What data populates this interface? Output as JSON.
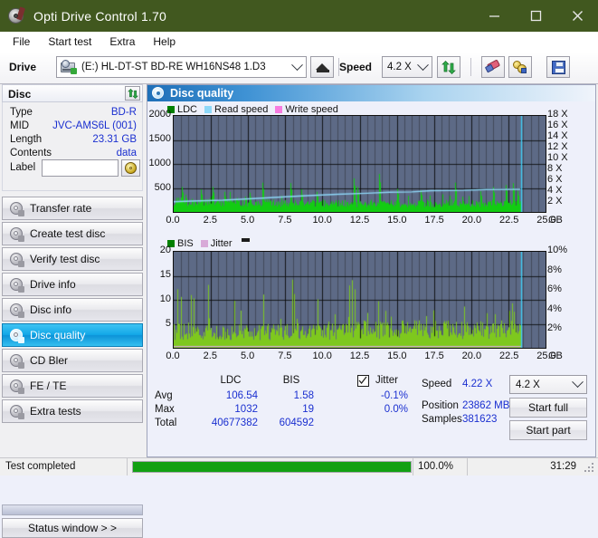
{
  "window": {
    "title": "Opti Drive Control 1.70",
    "minimize": "minimize-button",
    "maximize": "maximize-button",
    "close": "close-button"
  },
  "menu": [
    "File",
    "Start test",
    "Extra",
    "Help"
  ],
  "drive_bar": {
    "drive_label": "Drive",
    "drive_value": "(E:)  HL-DT-ST BD-RE  WH16NS48 1.D3",
    "speed_label": "Speed",
    "speed_value": "4.2 X"
  },
  "disc": {
    "header": "Disc",
    "rows": [
      {
        "key": "Type",
        "value": "BD-R"
      },
      {
        "key": "MID",
        "value": "JVC-AMS6L (001)"
      },
      {
        "key": "Length",
        "value": "23.31 GB"
      },
      {
        "key": "Contents",
        "value": "data"
      }
    ],
    "label_key": "Label",
    "label_value": ""
  },
  "nav": {
    "items": [
      {
        "label": "Transfer rate",
        "selected": false
      },
      {
        "label": "Create test disc",
        "selected": false
      },
      {
        "label": "Verify test disc",
        "selected": false
      },
      {
        "label": "Drive info",
        "selected": false
      },
      {
        "label": "Disc info",
        "selected": false
      },
      {
        "label": "Disc quality",
        "selected": true
      },
      {
        "label": "CD Bler",
        "selected": false
      },
      {
        "label": "FE / TE",
        "selected": false
      },
      {
        "label": "Extra tests",
        "selected": false
      }
    ],
    "status_window": "Status window > >"
  },
  "panel": {
    "title": "Disc quality"
  },
  "stats": {
    "col_ldc": "LDC",
    "col_bis": "BIS",
    "jitter_label": "Jitter",
    "jitter_checked": true,
    "rows": [
      {
        "name": "Avg",
        "ldc": "106.54",
        "bis": "1.58",
        "jitter": "-0.1%"
      },
      {
        "name": "Max",
        "ldc": "1032",
        "bis": "19",
        "jitter": "0.0%"
      },
      {
        "name": "Total",
        "ldc": "40677382",
        "bis": "604592",
        "jitter": ""
      }
    ],
    "speed_label": "Speed",
    "speed_value": "4.22 X",
    "position_label": "Position",
    "position_value": "23862 MB",
    "samples_label": "Samples",
    "samples_value": "381623",
    "result_speed": "4.2 X",
    "start_full": "Start full",
    "start_part": "Start part"
  },
  "statusbar": {
    "message": "Test completed",
    "percent": "100.0%",
    "percent_value": 100,
    "time": "31:29"
  },
  "colors": {
    "title_bg": "#41581f",
    "plot_bg": "#5d6a86",
    "ldc_green": "#12cc12",
    "bis_green": "#7ec81e",
    "read_speed": "#8ed8f8",
    "write_speed": "#f77ce0",
    "jitter_pink": "#d8aad8",
    "value_blue": "#1a2fd0",
    "progress_green": "#12a012",
    "selected_nav": "#12a8e8"
  },
  "chart_data": [
    {
      "type": "area",
      "id": "ldc-chart",
      "title": "",
      "xlabel": "GB",
      "ylabel": "",
      "legend": [
        {
          "label": "LDC",
          "color": "#008000"
        },
        {
          "label": "Read speed",
          "color": "#8ed8f8"
        },
        {
          "label": "Write speed",
          "color": "#f77ce0"
        }
      ],
      "legend_position": "top-left",
      "grid": true,
      "x": {
        "min": 0.0,
        "max": 25.0,
        "ticks": [
          0.0,
          2.5,
          5.0,
          7.5,
          10.0,
          12.5,
          15.0,
          17.5,
          20.0,
          22.5,
          25.0
        ],
        "ticklabels": [
          "0.0",
          "2.5",
          "5.0",
          "7.5",
          "10.0",
          "12.5",
          "15.0",
          "17.5",
          "20.0",
          "22.5",
          "25.0"
        ],
        "unit": "GB"
      },
      "y_left": {
        "min": 0,
        "max": 2000,
        "ticks": [
          0,
          500,
          1000,
          1500,
          2000
        ],
        "ticklabels": [
          "",
          "500",
          "1000",
          "1500",
          "2000"
        ]
      },
      "y_right": {
        "min": 0,
        "max": 18,
        "ticks": [
          2,
          4,
          6,
          8,
          10,
          12,
          14,
          16,
          18
        ],
        "ticklabels": [
          "2 X",
          "4 X",
          "6 X",
          "8 X",
          "10 X",
          "12 X",
          "14 X",
          "16 X",
          "18 X"
        ]
      },
      "data_end_x": 23.35,
      "series": [
        {
          "name": "LDC",
          "color": "#12cc12",
          "axis": "left",
          "baseline": [
            230,
            250,
            235,
            215,
            210,
            205,
            200,
            198,
            205,
            215,
            225,
            210,
            200,
            195,
            200,
            205,
            210,
            200,
            195,
            200,
            205,
            195,
            190,
            185,
            190,
            195,
            200,
            205,
            195,
            190,
            185,
            180,
            185,
            190,
            195,
            185,
            180,
            175,
            180,
            185,
            190,
            185,
            180,
            175,
            180,
            185,
            190,
            195,
            190,
            185,
            180,
            175,
            170,
            175,
            180,
            185,
            190,
            185,
            180,
            175,
            180,
            185,
            190,
            185,
            180,
            175,
            180,
            185,
            180,
            175,
            180,
            185,
            190,
            185,
            180,
            175,
            180,
            185,
            190,
            195,
            185,
            180,
            175,
            180,
            185,
            190,
            185,
            180,
            175,
            180,
            185,
            190,
            185,
            180,
            185,
            190,
            195,
            190,
            185,
            180
          ],
          "peaks": [
            {
              "x": 0.55,
              "y": 520
            },
            {
              "x": 1.8,
              "y": 470
            },
            {
              "x": 2.6,
              "y": 520
            },
            {
              "x": 3.4,
              "y": 420
            },
            {
              "x": 5.1,
              "y": 400
            },
            {
              "x": 5.95,
              "y": 610
            },
            {
              "x": 7.85,
              "y": 600
            },
            {
              "x": 8.6,
              "y": 470
            },
            {
              "x": 9.6,
              "y": 420
            },
            {
              "x": 12.1,
              "y": 700
            },
            {
              "x": 12.35,
              "y": 520
            },
            {
              "x": 13.8,
              "y": 790
            },
            {
              "x": 15.0,
              "y": 480
            },
            {
              "x": 16.6,
              "y": 450
            },
            {
              "x": 18.9,
              "y": 610
            },
            {
              "x": 20.6,
              "y": 430
            },
            {
              "x": 21.5,
              "y": 520
            },
            {
              "x": 22.3,
              "y": 560
            },
            {
              "x": 22.8,
              "y": 600
            },
            {
              "x": 23.1,
              "y": 440
            }
          ]
        },
        {
          "name": "Read speed",
          "color": "#8ed8f8",
          "axis": "right",
          "points": [
            {
              "x": 0.0,
              "y": 1.9
            },
            {
              "x": 1.2,
              "y": 2.05
            },
            {
              "x": 3.3,
              "y": 2.2
            },
            {
              "x": 5.1,
              "y": 2.45
            },
            {
              "x": 7.0,
              "y": 2.75
            },
            {
              "x": 9.0,
              "y": 3.05
            },
            {
              "x": 11.0,
              "y": 3.3
            },
            {
              "x": 13.0,
              "y": 3.5
            },
            {
              "x": 14.5,
              "y": 3.7
            },
            {
              "x": 16.0,
              "y": 3.75
            },
            {
              "x": 17.3,
              "y": 4.0
            },
            {
              "x": 19.5,
              "y": 4.05
            },
            {
              "x": 21.0,
              "y": 4.2
            },
            {
              "x": 23.3,
              "y": 4.25
            }
          ]
        },
        {
          "name": "cursor",
          "color": "#3fd0f7",
          "type": "vline",
          "x": 23.35
        }
      ]
    },
    {
      "type": "area",
      "id": "bis-chart",
      "title": "",
      "xlabel": "GB",
      "ylabel": "",
      "legend": [
        {
          "label": "BIS",
          "color": "#008000"
        },
        {
          "label": "Jitter",
          "color": "#d8aad8"
        }
      ],
      "legend_position": "top-left",
      "grid": true,
      "x": {
        "min": 0.0,
        "max": 25.0,
        "ticks": [
          0.0,
          2.5,
          5.0,
          7.5,
          10.0,
          12.5,
          15.0,
          17.5,
          20.0,
          22.5,
          25.0
        ],
        "ticklabels": [
          "0.0",
          "2.5",
          "5.0",
          "7.5",
          "10.0",
          "12.5",
          "15.0",
          "17.5",
          "20.0",
          "22.5",
          "25.0"
        ],
        "unit": "GB"
      },
      "y_left": {
        "min": 0,
        "max": 20,
        "ticks": [
          5,
          10,
          15,
          20
        ],
        "ticklabels": [
          "5",
          "10",
          "15",
          "20"
        ]
      },
      "y_right": {
        "min": 0,
        "max": 10,
        "ticks": [
          2,
          4,
          6,
          8,
          10
        ],
        "ticklabels": [
          "2%",
          "4%",
          "6%",
          "8%",
          "10%"
        ]
      },
      "data_end_x": 23.35,
      "series": [
        {
          "name": "BIS",
          "color": "#7ec81e",
          "axis": "left",
          "baseline_first_half": 4.6,
          "baseline_second_half": 5.2,
          "noise_amp": 2.2,
          "peaks": [
            {
              "x": 0.25,
              "y": 12.2
            },
            {
              "x": 0.5,
              "y": 10.6
            },
            {
              "x": 1.15,
              "y": 11.0
            },
            {
              "x": 1.35,
              "y": 10.3
            },
            {
              "x": 2.3,
              "y": 13.1
            },
            {
              "x": 4.1,
              "y": 9.8
            },
            {
              "x": 6.0,
              "y": 11.1
            },
            {
              "x": 7.95,
              "y": 14.2
            },
            {
              "x": 8.1,
              "y": 11.2
            },
            {
              "x": 9.7,
              "y": 10.1
            },
            {
              "x": 11.8,
              "y": 13.0
            },
            {
              "x": 12.0,
              "y": 14.1
            },
            {
              "x": 12.15,
              "y": 12.2
            },
            {
              "x": 13.75,
              "y": 9.7
            },
            {
              "x": 14.6,
              "y": 6.5
            },
            {
              "x": 17.45,
              "y": 7.8
            },
            {
              "x": 19.55,
              "y": 8.6
            },
            {
              "x": 21.6,
              "y": 7.0
            },
            {
              "x": 22.55,
              "y": 7.7
            },
            {
              "x": 22.85,
              "y": 7.5
            }
          ]
        },
        {
          "name": "Jitter",
          "color": "#d8aad8",
          "axis": "right",
          "value": 0.05
        },
        {
          "name": "cursor",
          "color": "#3fd0f7",
          "type": "vline",
          "x": 23.35
        }
      ]
    }
  ]
}
